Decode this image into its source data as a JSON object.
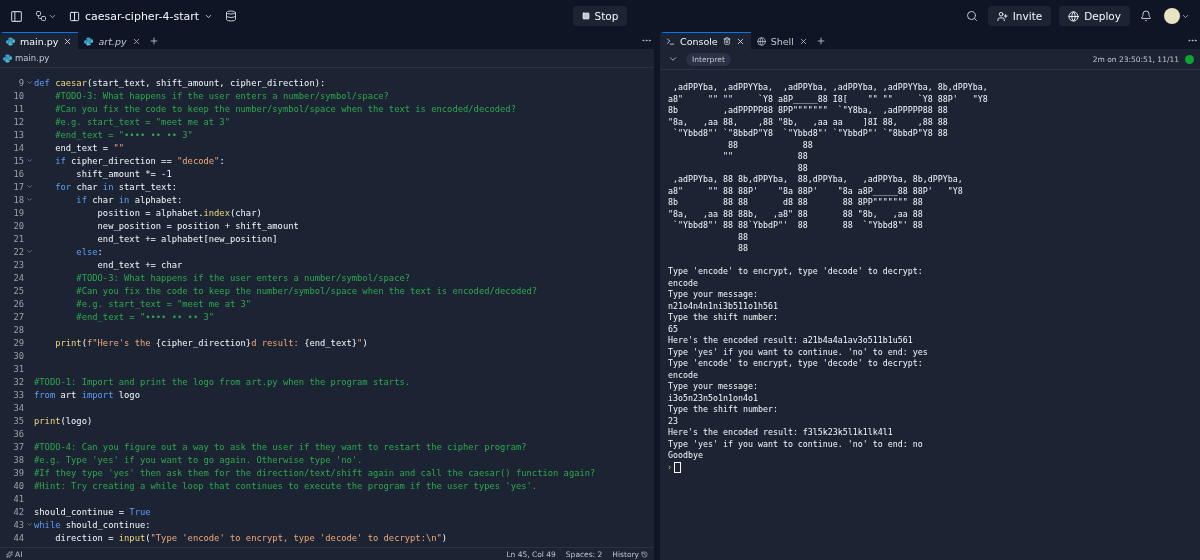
{
  "top_bar": {
    "project": "caesar-cipher-4-start",
    "run_button": "Stop",
    "invite_button": "Invite",
    "deploy_button": "Deploy"
  },
  "editor": {
    "tabs": [
      {
        "label": "main.py",
        "selected": true
      },
      {
        "label": "art.py",
        "selected": false
      }
    ],
    "breadcrumb": "main.py",
    "lines": [
      {
        "number": "9",
        "foldable": true,
        "segments": [
          {
            "kind": "kw",
            "t": "def "
          },
          {
            "kind": "fn",
            "t": "caesar"
          },
          {
            "kind": "p",
            "t": "(start_text, shift_amount, cipher_direction):"
          }
        ]
      },
      {
        "number": "10",
        "foldable": false,
        "segments": [
          {
            "kind": "cm",
            "t": "    #TODO-3: What happens if the user enters a number/symbol/space?"
          }
        ]
      },
      {
        "number": "11",
        "foldable": false,
        "segments": [
          {
            "kind": "cm",
            "t": "    #Can you fix the code to keep the number/symbol/space when the text is encoded/decoded?"
          }
        ]
      },
      {
        "number": "12",
        "foldable": false,
        "segments": [
          {
            "kind": "cm",
            "t": "    #e.g. start_text = \"meet me at 3\""
          }
        ]
      },
      {
        "number": "13",
        "foldable": false,
        "segments": [
          {
            "kind": "cm",
            "t": "    #end_text = \"•••• •• •• 3\""
          }
        ]
      },
      {
        "number": "14",
        "foldable": false,
        "segments": [
          {
            "kind": "p",
            "t": "    end_text = "
          },
          {
            "kind": "str",
            "t": "\"\""
          }
        ]
      },
      {
        "number": "15",
        "foldable": true,
        "segments": [
          {
            "kind": "kw",
            "t": "    if "
          },
          {
            "kind": "p",
            "t": "cipher_direction == "
          },
          {
            "kind": "str",
            "t": "\"decode\""
          },
          {
            "kind": "p",
            "t": ":"
          }
        ]
      },
      {
        "number": "16",
        "foldable": false,
        "segments": [
          {
            "kind": "p",
            "t": "        shift_amount *= -1"
          }
        ]
      },
      {
        "number": "17",
        "foldable": true,
        "segments": [
          {
            "kind": "kw",
            "t": "    for "
          },
          {
            "kind": "p",
            "t": "char "
          },
          {
            "kind": "kw",
            "t": "in "
          },
          {
            "kind": "p",
            "t": "start_text:"
          }
        ]
      },
      {
        "number": "18",
        "foldable": true,
        "segments": [
          {
            "kind": "kw",
            "t": "        if "
          },
          {
            "kind": "p",
            "t": "char "
          },
          {
            "kind": "kw",
            "t": "in "
          },
          {
            "kind": "p",
            "t": "alphabet:"
          }
        ]
      },
      {
        "number": "19",
        "foldable": false,
        "segments": [
          {
            "kind": "p",
            "t": "            position = alphabet."
          },
          {
            "kind": "fn",
            "t": "index"
          },
          {
            "kind": "p",
            "t": "(char)"
          }
        ]
      },
      {
        "number": "20",
        "foldable": false,
        "segments": [
          {
            "kind": "p",
            "t": "            new_position = position + shift_amount"
          }
        ]
      },
      {
        "number": "21",
        "foldable": false,
        "segments": [
          {
            "kind": "p",
            "t": "            end_text += alphabet[new_position]"
          }
        ]
      },
      {
        "number": "22",
        "foldable": true,
        "segments": [
          {
            "kind": "kw",
            "t": "        else"
          },
          {
            "kind": "p",
            "t": ":"
          }
        ]
      },
      {
        "number": "23",
        "foldable": false,
        "segments": [
          {
            "kind": "p",
            "t": "            end_text += char"
          }
        ]
      },
      {
        "number": "24",
        "foldable": false,
        "segments": [
          {
            "kind": "cm",
            "t": "        #TODO-3: What happens if the user enters a number/symbol/space?"
          }
        ]
      },
      {
        "number": "25",
        "foldable": false,
        "segments": [
          {
            "kind": "cm",
            "t": "        #Can you fix the code to keep the number/symbol/space when the text is encoded/decoded?"
          }
        ]
      },
      {
        "number": "26",
        "foldable": false,
        "segments": [
          {
            "kind": "cm",
            "t": "        #e.g. start_text = \"meet me at 3\""
          }
        ]
      },
      {
        "number": "27",
        "foldable": false,
        "segments": [
          {
            "kind": "cm",
            "t": "        #end_text = \"•••• •• •• 3\""
          }
        ]
      },
      {
        "number": "28",
        "foldable": false
      },
      {
        "number": "29",
        "foldable": false,
        "segments": [
          {
            "kind": "fn",
            "t": "    print"
          },
          {
            "kind": "p",
            "t": "("
          },
          {
            "kind": "str",
            "t": "f\"Here's the "
          },
          {
            "kind": "p",
            "t": "{cipher_direction}"
          },
          {
            "kind": "str",
            "t": "d result: "
          },
          {
            "kind": "p",
            "t": "{end_text}"
          },
          {
            "kind": "str",
            "t": "\""
          },
          {
            "kind": "p",
            "t": ")"
          }
        ]
      },
      {
        "number": "30",
        "foldable": false
      },
      {
        "number": "31",
        "foldable": false
      },
      {
        "number": "32",
        "foldable": false,
        "segments": [
          {
            "kind": "cm",
            "t": "#TODO-1: Import and print the logo from art.py when the program starts."
          }
        ]
      },
      {
        "number": "33",
        "foldable": false,
        "segments": [
          {
            "kind": "kw",
            "t": "from "
          },
          {
            "kind": "p",
            "t": "art "
          },
          {
            "kind": "kw",
            "t": "import "
          },
          {
            "kind": "p",
            "t": "logo"
          }
        ]
      },
      {
        "number": "34",
        "foldable": false
      },
      {
        "number": "35",
        "foldable": false,
        "segments": [
          {
            "kind": "fn",
            "t": "print"
          },
          {
            "kind": "p",
            "t": "(logo)"
          }
        ]
      },
      {
        "number": "36",
        "foldable": false
      },
      {
        "number": "37",
        "foldable": false,
        "segments": [
          {
            "kind": "cm",
            "t": "#TODO-4: Can you figure out a way to ask the user if they want to restart the cipher program?"
          }
        ]
      },
      {
        "number": "38",
        "foldable": false,
        "segments": [
          {
            "kind": "cm",
            "t": "#e.g. Type 'yes' if you want to go again. Otherwise type 'no'."
          }
        ]
      },
      {
        "number": "39",
        "foldable": false,
        "segments": [
          {
            "kind": "cm",
            "t": "#If they type 'yes' then ask them for the direction/text/shift again and call the caesar() function again?"
          }
        ]
      },
      {
        "number": "40",
        "foldable": false,
        "segments": [
          {
            "kind": "cm",
            "t": "#Hint: Try creating a while loop that continues to execute the program if the user types 'yes'."
          }
        ]
      },
      {
        "number": "41",
        "foldable": false
      },
      {
        "number": "42",
        "foldable": false,
        "segments": [
          {
            "kind": "p",
            "t": "should_continue = "
          },
          {
            "kind": "kw",
            "t": "True"
          }
        ]
      },
      {
        "number": "43",
        "foldable": true,
        "segments": [
          {
            "kind": "kw",
            "t": "while "
          },
          {
            "kind": "p",
            "t": "should_continue:"
          }
        ]
      },
      {
        "number": "44",
        "foldable": false,
        "segments": [
          {
            "kind": "p",
            "t": "    direction = "
          },
          {
            "kind": "fn",
            "t": "input"
          },
          {
            "kind": "p",
            "t": "("
          },
          {
            "kind": "str",
            "t": "\"Type 'encode' to encrypt, type 'decode' to decrypt:\\n\""
          },
          {
            "kind": "p",
            "t": ")"
          }
        ]
      }
    ],
    "status_bar": {
      "ai": "AI",
      "cursor": "Ln 45, Col 49",
      "spaces": "Spaces: 2",
      "history": "History"
    }
  },
  "console": {
    "tabs": [
      {
        "label": "Console",
        "selected": true
      },
      {
        "label": "Shell",
        "selected": false
      }
    ],
    "mode": "Interpret",
    "last_run": "2m on 23:50:51, 11/11",
    "output": [
      " ,adPPYba, ,adPPYYba,  ,adPPYba, ,adPPYba, ,adPPYYba, 8b,dPPYba,",
      "a8\"     \"\" \"\"     `Y8 a8P_____88 I8[    \"\" \"\"     `Y8 88P'   \"Y8",
      "8b         ,adPPPPP88 8PP\"\"\"\"\"\"\"  `\"Y8ba,  ,adPPPPP88 88",
      "\"8a,   ,aa 88,    ,88 \"8b,   ,aa aa    ]8I 88,    ,88 88",
      " `\"Ybbd8\"' `\"8bbdP\"Y8  `\"Ybbd8\"' `\"YbbdP\"' `\"8bbdP\"Y8 88",
      "            88             88",
      "           \"\"             88",
      "                          88",
      " ,adPPYba, 88 8b,dPPYba,  88,dPPYba,   ,adPPYba, 8b,dPPYba,",
      "a8\"     \"\" 88 88P'    \"8a 88P'    \"8a a8P_____88 88P'   \"Y8",
      "8b         88 88       d8 88       88 8PP\"\"\"\"\"\"\" 88",
      "\"8a,   ,aa 88 88b,   ,a8\" 88       88 \"8b,   ,aa 88",
      " `\"Ybbd8\"' 88 88`YbbdP\"'  88       88  `\"Ybbd8\"' 88",
      "              88",
      "              88"
    ],
    "transcript": [
      "Type 'encode' to encrypt, type 'decode' to decrypt:",
      "encode",
      "Type your message:",
      "n21o4n4n1ni3b511o1h561",
      "Type the shift number:",
      "65",
      "Here's the encoded result: a21b4a4a1av3o511b1u561",
      "Type 'yes' if you want to continue. 'no' to end: yes",
      "Type 'encode' to encrypt, type 'decode' to decrypt:",
      "encode",
      "Type your message:",
      "i3o5n23n5o1n1on4o1",
      "Type the shift number:",
      "23",
      "Here's the encoded result: f3l5k23k5l1k1lk4l1",
      "Type 'yes' if you want to continue. 'no' to end: no",
      "Goodbye"
    ],
    "prompt": "›"
  }
}
